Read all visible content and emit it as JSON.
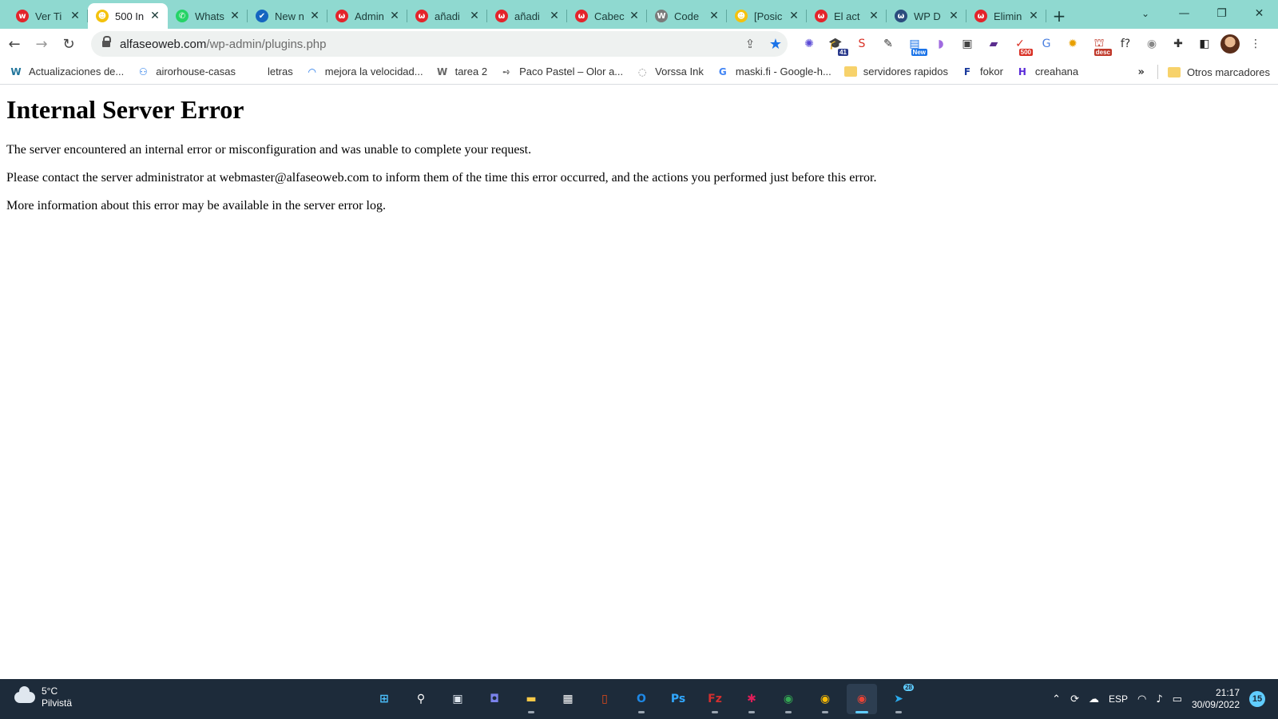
{
  "browser": {
    "tabs": [
      {
        "title": "Ver Ti",
        "icon": "wordfence-icon",
        "color": "#e3242b",
        "glyph": "w",
        "active": false
      },
      {
        "title": "500 In",
        "icon": "yoast-icon",
        "color": "#f4c20d",
        "glyph": "☻",
        "active": true
      },
      {
        "title": "Whats",
        "icon": "whatsapp-icon",
        "color": "#25d366",
        "glyph": "✆",
        "active": false
      },
      {
        "title": "New n",
        "icon": "checkmark-icon",
        "color": "#1565c0",
        "glyph": "✔",
        "active": false
      },
      {
        "title": "Admin",
        "icon": "wordfence-icon",
        "color": "#e3242b",
        "glyph": "ω",
        "active": false
      },
      {
        "title": "añadi",
        "icon": "wordfence-icon",
        "color": "#e3242b",
        "glyph": "ω",
        "active": false
      },
      {
        "title": "añadi",
        "icon": "wordfence-icon",
        "color": "#e3242b",
        "glyph": "ω",
        "active": false
      },
      {
        "title": "Cabec",
        "icon": "wordfence-icon",
        "color": "#e3242b",
        "glyph": "ω",
        "active": false
      },
      {
        "title": "Code",
        "icon": "wordpress-icon",
        "color": "#7a7a7a",
        "glyph": "W",
        "active": false
      },
      {
        "title": "[Posic",
        "icon": "yoast-icon",
        "color": "#f4c20d",
        "glyph": "☻",
        "active": false
      },
      {
        "title": "El act",
        "icon": "wordfence-icon",
        "color": "#e3242b",
        "glyph": "ω",
        "active": false
      },
      {
        "title": "WP D",
        "icon": "wordfence-icon",
        "color": "#2b4c7e",
        "glyph": "ω",
        "active": false
      },
      {
        "title": "Elimin",
        "icon": "wordfence-icon",
        "color": "#e3242b",
        "glyph": "ω",
        "active": false
      }
    ],
    "new_tab": "+",
    "close_glyph": "✕",
    "url_host": "alfaseoweb.com",
    "url_path": "/wp-admin/plugins.php",
    "extensions": [
      {
        "name": "snowflake-extension-icon",
        "glyph": "✺",
        "color": "#5b4bd6",
        "badge": ""
      },
      {
        "name": "graduation-cap-extension-icon",
        "glyph": "🎓",
        "color": "#2b3a8c",
        "badge": "41",
        "badge_color": "#2b3a8c"
      },
      {
        "name": "s-extension-icon",
        "glyph": "S",
        "color": "#d93025",
        "badge": ""
      },
      {
        "name": "pen-extension-icon",
        "glyph": "✎",
        "color": "#333333",
        "badge": ""
      },
      {
        "name": "new-extension-icon",
        "glyph": "▤",
        "color": "#1a73e8",
        "badge": "New",
        "badge_color": "#1a73e8"
      },
      {
        "name": "wing-extension-icon",
        "glyph": "◗",
        "color": "#a06be0",
        "badge": ""
      },
      {
        "name": "image-extension-icon",
        "glyph": "▣",
        "color": "#444444",
        "badge": ""
      },
      {
        "name": "chart-extension-icon",
        "glyph": "▰",
        "color": "#5b2d8e",
        "badge": ""
      },
      {
        "name": "status-code-extension-icon",
        "glyph": "✓",
        "color": "#d93025",
        "badge": "500",
        "badge_color": "#d93025"
      },
      {
        "name": "translate-extension-icon",
        "glyph": "G",
        "color": "#4a7fe0",
        "badge": ""
      },
      {
        "name": "seo-extension-icon",
        "glyph": "✹",
        "color": "#e8a000",
        "badge": ""
      },
      {
        "name": "desc-extension-icon",
        "glyph": "⛫",
        "color": "#c0392b",
        "badge": "desc",
        "badge_color": "#c0392b"
      },
      {
        "name": "font-extension-icon",
        "glyph": "f?",
        "color": "#333333",
        "badge": ""
      },
      {
        "name": "camera-extension-icon",
        "glyph": "◉",
        "color": "#888888",
        "badge": ""
      },
      {
        "name": "puzzle-extension-icon",
        "glyph": "✚",
        "color": "#333333",
        "badge": ""
      },
      {
        "name": "sidepanel-icon",
        "glyph": "◧",
        "color": "#222222",
        "badge": ""
      }
    ],
    "bookmarks": [
      {
        "label": "Actualizaciones de...",
        "icon": "wordpress-icon",
        "glyph": "W",
        "color": "#21759b"
      },
      {
        "label": "airorhouse-casas",
        "icon": "people-icon",
        "glyph": "⚇",
        "color": "#1a73e8"
      },
      {
        "label": "letras",
        "icon": "blank-icon",
        "glyph": "",
        "color": "#ffffff"
      },
      {
        "label": "mejora la velocidad...",
        "icon": "arc-icon",
        "glyph": "◠",
        "color": "#1a73e8"
      },
      {
        "label": "tarea 2",
        "icon": "wordpress-icon",
        "glyph": "W",
        "color": "#666666"
      },
      {
        "label": "Paco Pastel – Olor a...",
        "icon": "arrow-icon",
        "glyph": "➺",
        "color": "#666666"
      },
      {
        "label": "Vorssa Ink",
        "icon": "globe-icon",
        "glyph": "◌",
        "color": "#888888"
      },
      {
        "label": "maski.fi - Google-h...",
        "icon": "google-icon",
        "glyph": "G",
        "color": "#4285f4"
      },
      {
        "label": "servidores rapidos",
        "icon": "folder-icon",
        "glyph": "",
        "color": "#f7d26b"
      },
      {
        "label": "fokor",
        "icon": "f-icon",
        "glyph": "F",
        "color": "#1a3a9c"
      },
      {
        "label": "creahana",
        "icon": "h-icon",
        "glyph": "H",
        "color": "#5a2bd8"
      }
    ],
    "more_bookmarks": "»",
    "other_bookmarks": "Otros marcadores"
  },
  "page": {
    "title": "Internal Server Error",
    "paragraphs": [
      "The server encountered an internal error or misconfiguration and was unable to complete your request.",
      "Please contact the server administrator at webmaster@alfaseoweb.com to inform them of the time this error occurred, and the actions you performed just before this error.",
      "More information about this error may be available in the server error log."
    ]
  },
  "taskbar": {
    "weather_temp": "5°C",
    "weather_desc": "Pilvistä",
    "apps": [
      {
        "name": "start-button",
        "glyph": "⊞",
        "color": "#4cc2ff",
        "active": false,
        "running": false,
        "badge": ""
      },
      {
        "name": "search-button",
        "glyph": "⚲",
        "color": "#ffffff",
        "active": false,
        "running": false,
        "badge": ""
      },
      {
        "name": "task-view-button",
        "glyph": "▣",
        "color": "#dfe7ef",
        "active": false,
        "running": false,
        "badge": ""
      },
      {
        "name": "teams-chat-button",
        "glyph": "◘",
        "color": "#7b83eb",
        "active": false,
        "running": false,
        "badge": ""
      },
      {
        "name": "file-explorer-button",
        "glyph": "▬",
        "color": "#f7c948",
        "active": false,
        "running": true,
        "badge": ""
      },
      {
        "name": "store-button",
        "glyph": "▦",
        "color": "#ffffff",
        "active": false,
        "running": false,
        "badge": ""
      },
      {
        "name": "office-button",
        "glyph": "▯",
        "color": "#e64a19",
        "active": false,
        "running": false,
        "badge": ""
      },
      {
        "name": "outlook-button",
        "glyph": "O",
        "color": "#1e88e5",
        "active": false,
        "running": true,
        "badge": ""
      },
      {
        "name": "photoshop-button",
        "glyph": "Ps",
        "color": "#31a8ff",
        "active": false,
        "running": false,
        "badge": ""
      },
      {
        "name": "filezilla-button",
        "glyph": "Fz",
        "color": "#d32f2f",
        "active": false,
        "running": true,
        "badge": ""
      },
      {
        "name": "slack-button",
        "glyph": "✱",
        "color": "#e01e5a",
        "active": false,
        "running": true,
        "badge": ""
      },
      {
        "name": "chrome-profile-1-button",
        "glyph": "◉",
        "color": "#34a853",
        "active": false,
        "running": true,
        "badge": ""
      },
      {
        "name": "chrome-profile-2-button",
        "glyph": "◉",
        "color": "#fbbc05",
        "active": false,
        "running": true,
        "badge": ""
      },
      {
        "name": "chrome-profile-3-button",
        "glyph": "◉",
        "color": "#ea4335",
        "active": true,
        "running": true,
        "badge": ""
      },
      {
        "name": "telegram-button",
        "glyph": "➤",
        "color": "#2aabee",
        "active": false,
        "running": true,
        "badge": "28"
      }
    ],
    "language": "ESP",
    "time": "21:17",
    "date": "30/09/2022",
    "notifications": "15"
  }
}
